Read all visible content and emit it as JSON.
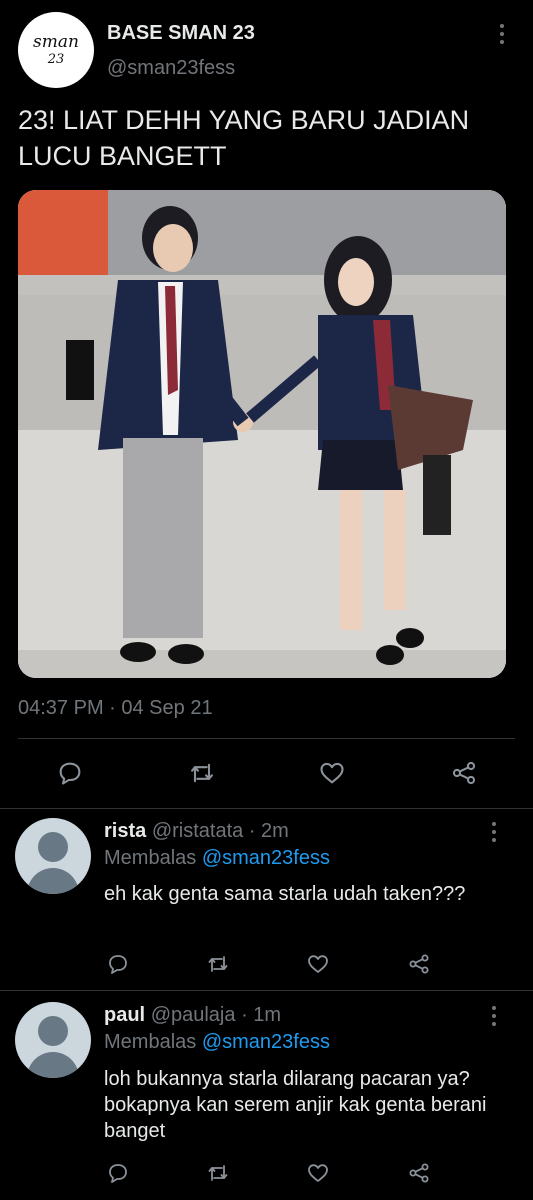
{
  "tweet": {
    "logo_line1": "sman",
    "logo_line2": "23",
    "author_name": "BASE SMAN 23",
    "author_handle": "@sman23fess",
    "text": "23! LIAT DEHH YANG BARU JADIAN LUCU BANGETT",
    "timestamp": "04:37 PM · 04 Sep 21",
    "actions": [
      "reply-icon",
      "retweet-icon",
      "like-icon",
      "share-icon"
    ]
  },
  "replies": [
    {
      "name": "rista",
      "handle": "@ristatata",
      "time": "· 2m",
      "replying_prefix": "Membalas",
      "replying_to": "@sman23fess",
      "text": "eh kak genta sama starla udah taken???"
    },
    {
      "name": "paul",
      "handle": "@paulaja",
      "time": "· 1m",
      "replying_prefix": "Membalas",
      "replying_to": "@sman23fess",
      "text": "loh bukannya starla dilarang pacaran ya? bokapnya kan serem anjir kak genta berani banget"
    }
  ],
  "colors": {
    "background": "#000000",
    "text": "#e7e9ea",
    "muted": "#71767b",
    "link": "#1d9bf0",
    "divider": "#2f3336"
  }
}
